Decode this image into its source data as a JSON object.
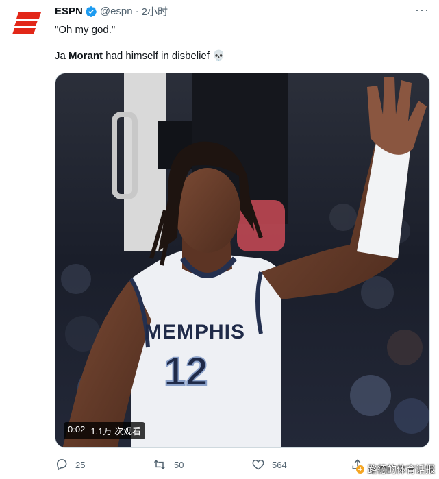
{
  "tweet": {
    "author_name": "ESPN",
    "handle": "@espn",
    "separator": "·",
    "time": "2小时",
    "line1": "\"Oh my god.\"",
    "line2_prefix": "Ja ",
    "line2_bold": "Morant",
    "line2_suffix": " had himself in disbelief ",
    "emoji": "💀",
    "more": "···"
  },
  "media": {
    "type": "video",
    "duration": "0:02",
    "views": "1.1万 次观看",
    "jersey_team": "MEMPHIS",
    "jersey_number": "12"
  },
  "actions": {
    "reply_count": "25",
    "retweet_count": "50",
    "like_count": "564"
  },
  "watermark": "路德的体育话报",
  "colors": {
    "brand": "#e22718",
    "verified": "#1d9bf0",
    "muted": "#536471"
  }
}
